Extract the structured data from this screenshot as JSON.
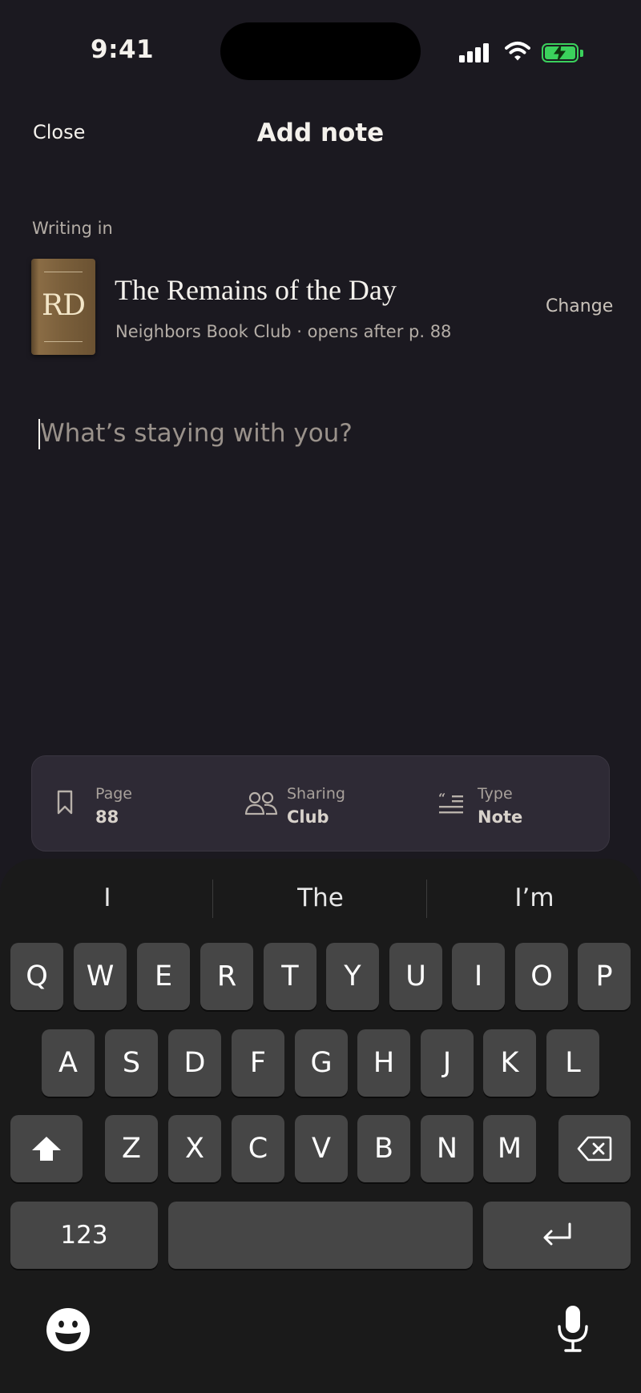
{
  "status_bar": {
    "time": "9:41"
  },
  "header": {
    "close_label": "Close",
    "title": "Add note"
  },
  "context": {
    "writing_in_label": "Writing in",
    "book": {
      "cover_initials": "RD",
      "title": "The Remains of the Day",
      "subtitle": "Neighbors Book Club · opens after p. 88"
    },
    "change_label": "Change"
  },
  "editor": {
    "placeholder": "What’s staying with you?",
    "value": ""
  },
  "meta_bar": {
    "items": [
      {
        "label": "Page",
        "value": "88",
        "icon": "bookmark-icon"
      },
      {
        "label": "Sharing",
        "value": "Club",
        "icon": "people-icon"
      },
      {
        "label": "Type",
        "value": "Note",
        "icon": "quote-lines-icon"
      }
    ]
  },
  "keyboard": {
    "suggestions": [
      "I",
      "The",
      "I’m"
    ],
    "row1": [
      "Q",
      "W",
      "E",
      "R",
      "T",
      "Y",
      "U",
      "I",
      "O",
      "P"
    ],
    "row2": [
      "A",
      "S",
      "D",
      "F",
      "G",
      "H",
      "J",
      "K",
      "L"
    ],
    "row3": [
      "Z",
      "X",
      "C",
      "V",
      "B",
      "N",
      "M"
    ],
    "numbers_label": "123",
    "colors": {
      "key": "#464646",
      "background": "#1a1a1a"
    }
  },
  "colors": {
    "background": "#1b1920",
    "accent_battery": "#3bd15c",
    "panel": "#2e2a35"
  }
}
